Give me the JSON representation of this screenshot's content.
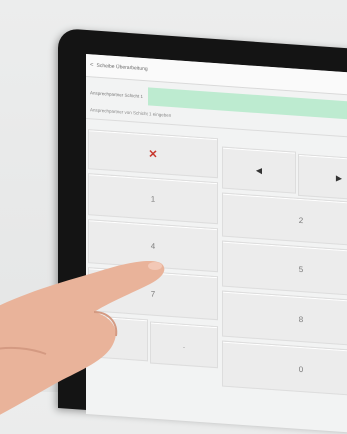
{
  "header": {
    "back_label": "<",
    "title": "Scheibe Überarbeitung"
  },
  "form": {
    "field_label": "Ansprechpartner Schicht 1",
    "field_value": "",
    "hint": "Ansprechpartner von Schicht 1 eingeben"
  },
  "keypad": {
    "clear": "✕",
    "left": "◀",
    "right": "▶",
    "keys": [
      "1",
      "2",
      "4",
      "5",
      "7",
      "8",
      "0",
      "."
    ]
  },
  "colors": {
    "input_bg": "#bdebd0",
    "clear": "#c8392f"
  }
}
